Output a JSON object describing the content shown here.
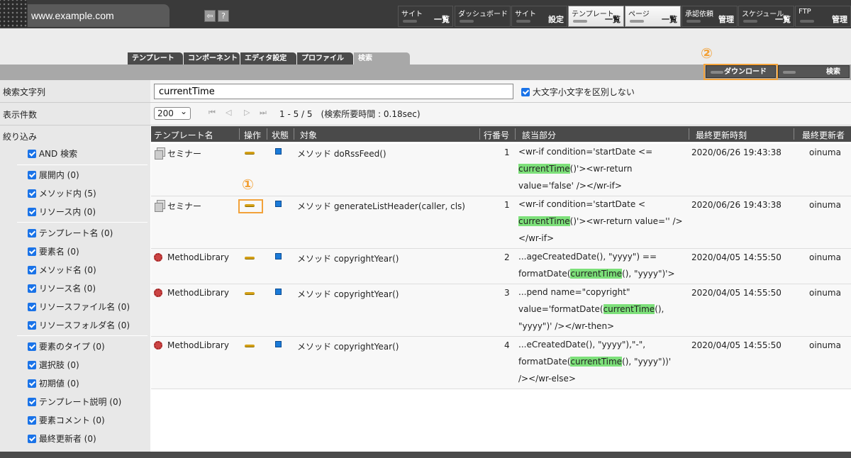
{
  "header": {
    "url": "www.example.com",
    "nav": [
      {
        "l1": "サイト",
        "l2": "一覧"
      },
      {
        "l1": "ダッシュボード",
        "l2": ""
      },
      {
        "l1": "サイト",
        "l2": "設定"
      },
      {
        "l1": "テンプレート",
        "l2": "一覧"
      },
      {
        "l1": "ページ",
        "l2": "一覧"
      },
      {
        "l1": "承認依頼",
        "l2": "管理"
      },
      {
        "l1": "スケジュール",
        "l2": "一覧"
      },
      {
        "l1": "FTP",
        "l2": "管理"
      }
    ]
  },
  "tabs": [
    "テンプレート",
    "コンポーネント",
    "エディタ設定",
    "プロファイル",
    "検索"
  ],
  "actions": {
    "download": "ダウンロード",
    "search": "検索"
  },
  "annotations": {
    "one": "①",
    "two": "②"
  },
  "form": {
    "search_label": "検索文字列",
    "search_value": "currentTime",
    "case_label": "大文字小文字を区別しない",
    "count_label": "表示件数",
    "count_value": "200",
    "page_info": "1 - 5  /  5　(検索所要時間 : 0.18sec)"
  },
  "filter": {
    "title": "絞り込み",
    "items": [
      "AND 検索",
      "展開内  (0)",
      "メソッド内  (5)",
      "リソース内  (0)",
      "テンプレート名  (0)",
      "要素名  (0)",
      "メソッド名  (0)",
      "リソース名  (0)",
      "リソースファイル名  (0)",
      "リソースフォルダ名  (0)",
      "要素のタイプ  (0)",
      "選択肢  (0)",
      "初期値  (0)",
      "テンプレート説明  (0)",
      "要素コメント  (0)",
      "最終更新者  (0)"
    ]
  },
  "table": {
    "headers": [
      "テンプレート名",
      "操作",
      "状態",
      "対象",
      "行番号",
      "該当部分",
      "最終更新時刻",
      "最終更新者"
    ],
    "rows": [
      {
        "name": "セミナー",
        "target": "メソッド doRssFeed()",
        "line": "1",
        "match": [
          [
            "<wr-if condition='startDate <=",
            ""
          ],
          [
            "",
            "currentTime",
            "()'><wr-return"
          ],
          [
            "value='false' /></wr-if>",
            ""
          ]
        ],
        "time": "2020/06/26 19:43:38",
        "user": "oinuma"
      },
      {
        "name": "セミナー",
        "target": "メソッド generateListHeader(caller, cls)",
        "line": "1",
        "match": [
          [
            "<wr-if condition='startDate <",
            ""
          ],
          [
            "",
            "currentTime",
            "()'><wr-return value='' />"
          ],
          [
            "</wr-if>",
            ""
          ]
        ],
        "time": "2020/06/26 19:43:38",
        "user": "oinuma"
      },
      {
        "name": "MethodLibrary",
        "target": "メソッド copyrightYear()",
        "line": "2",
        "match": [
          [
            "...ageCreatedDate(), \"yyyy\") ==",
            ""
          ],
          [
            "formatDate(",
            "currentTime",
            "(), \"yyyy\")'>"
          ]
        ],
        "time": "2020/04/05 14:55:50",
        "user": "oinuma"
      },
      {
        "name": "MethodLibrary",
        "target": "メソッド copyrightYear()",
        "line": "3",
        "match": [
          [
            "...pend name=\"copyright\"",
            ""
          ],
          [
            "value='formatDate(",
            "currentTime",
            "(),"
          ],
          [
            "\"yyyy\")' /></wr-then>",
            ""
          ]
        ],
        "time": "2020/04/05 14:55:50",
        "user": "oinuma"
      },
      {
        "name": "MethodLibrary",
        "target": "メソッド copyrightYear()",
        "line": "4",
        "match": [
          [
            "...eCreatedDate(), \"yyyy\"),\"-\",",
            ""
          ],
          [
            "formatDate(",
            "currentTime",
            "(), \"yyyy\"))'"
          ],
          [
            "/></wr-else>",
            ""
          ]
        ],
        "time": "2020/04/05 14:55:50",
        "user": "oinuma"
      }
    ]
  }
}
